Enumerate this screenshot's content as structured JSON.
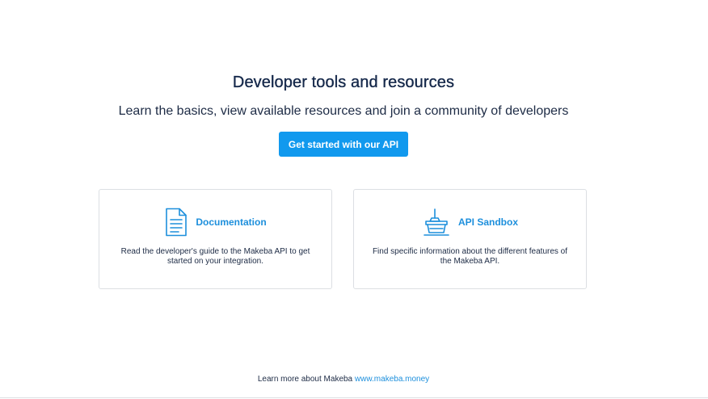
{
  "hero": {
    "title": "Developer tools and resources",
    "subtitle": "Learn the basics, view available resources and join a community of developers",
    "cta_label": "Get started with our API"
  },
  "cards": [
    {
      "title": "Documentation",
      "icon": "document-icon",
      "description": "Read the developer's guide to the Makeba API to get started on your integration."
    },
    {
      "title": "API Sandbox",
      "icon": "sandbox-icon",
      "description": "Find specific information about the different features of the Makeba API."
    }
  ],
  "footer": {
    "text": "Learn more about Makeba ",
    "link_text": "www.makeba.money"
  },
  "colors": {
    "accent": "#1199ee",
    "link": "#1d8fdc",
    "heading": "#15284a",
    "border": "#dcdfe3"
  }
}
